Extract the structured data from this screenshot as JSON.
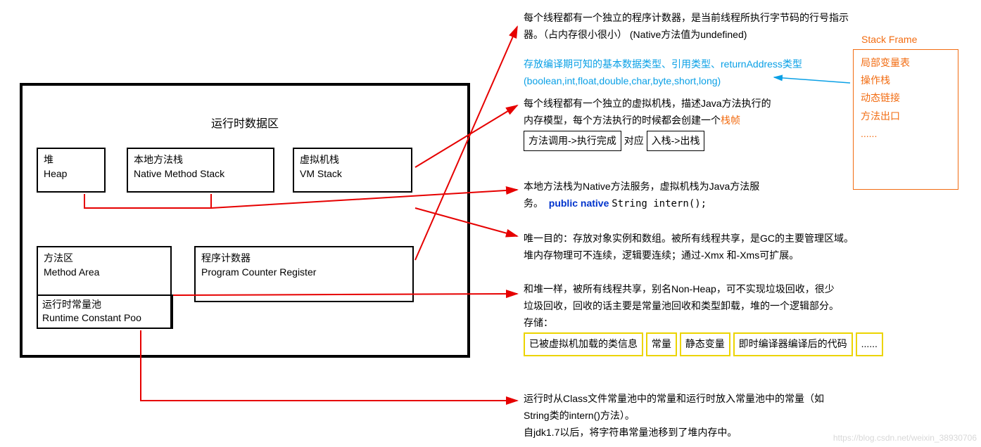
{
  "runtime_title": "运行时数据区",
  "boxes": {
    "heap_cn": "堆",
    "heap_en": "Heap",
    "nms_cn": "本地方法栈",
    "nms_en": "Native Method Stack",
    "vms_cn": "虚拟机栈",
    "vms_en": "VM Stack",
    "ma_cn": "方法区",
    "ma_en": "Method Area",
    "rcp_cn": "运行时常量池",
    "rcp_en": "Runtime Constant Poo",
    "pcr_cn": "程序计数器",
    "pcr_en": "Program Counter Register"
  },
  "desc": {
    "pc1": "每个线程都有一个独立的程序计数器，是当前线程所执行字节码的行号指示",
    "pc2": "器。（占内存很小很小）",
    "pc2_native": "(Native方法值为undefined)",
    "lvt1": "存放编译期可知的基本数据类型、引用类型、returnAddress类型",
    "lvt2": "(boolean,int,float,double,char,byte,short,long)",
    "vms1": "每个线程都有一个独立的虚拟机栈，描述Java方法执行的",
    "vms2": "内存模型，每个方法执行的时候都会创建一个",
    "frame_word": "栈帧",
    "call_box": "方法调用->执行完成",
    "dydy": "对应",
    "stack_box": "入栈->出栈",
    "nms1": "本地方法栈为Native方法服务，虚拟机栈为Java方法服",
    "nms2": "务。",
    "code": "String intern();",
    "code_kw": "public native",
    "heap1": "唯一目的：存放对象实例和数组。被所有线程共享，是GC的主要管理区域。",
    "heap2": "堆内存物理可不连续，逻辑要连续；通过-Xmx 和-Xms可扩展。",
    "ma1": "和堆一样，被所有线程共享，别名Non-Heap，可不实现垃圾回收，很少",
    "ma2": "垃圾回收，回收的话主要是常量池回收和类型卸载，堆的一个逻辑部分。",
    "ma3": "存储：",
    "ma_y1": "已被虚拟机加载的类信息",
    "ma_y2": "常量",
    "ma_y3": "静态变量",
    "ma_y4": "即时编译器编译后的代码",
    "ma_y5": "......",
    "rcp1": "运行时从Class文件常量池中的常量和运行时放入常量池中的常量（如",
    "rcp2": "String类的intern()方法）。",
    "rcp3": "自jdk1.7以后，将字符串常量池移到了堆内存中。"
  },
  "stack_frame": {
    "title": "Stack Frame",
    "i1": "局部变量表",
    "i2": "操作栈",
    "i3": "动态链接",
    "i4": "方法出口",
    "i5": "......"
  },
  "watermark": "https://blog.csdn.net/weixin_38930706"
}
